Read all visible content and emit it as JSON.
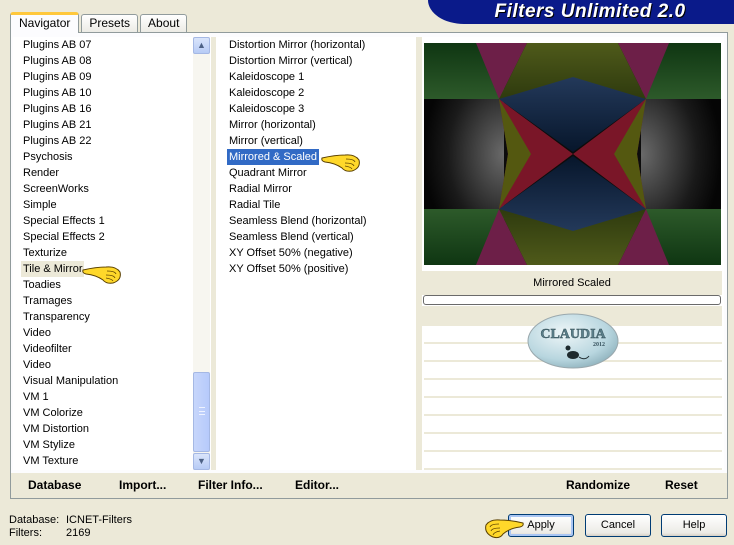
{
  "app": {
    "title": "Filters Unlimited 2.0"
  },
  "tabs": [
    {
      "label": "Navigator",
      "active": true
    },
    {
      "label": "Presets",
      "active": false
    },
    {
      "label": "About",
      "active": false
    }
  ],
  "categories": {
    "items": [
      "Plugins AB 07",
      "Plugins AB 08",
      "Plugins AB 09",
      "Plugins AB 10",
      "Plugins AB 16",
      "Plugins AB 21",
      "Plugins AB 22",
      "Psychosis",
      "Render",
      "ScreenWorks",
      "Simple",
      "Special Effects 1",
      "Special Effects 2",
      "Texturize",
      "Tile & Mirror",
      "Toadies",
      "Tramages",
      "Transparency",
      "Video",
      "Videofilter",
      "Video",
      "Visual Manipulation",
      "VM 1",
      "VM Colorize",
      "VM Distortion",
      "VM Stylize",
      "VM Texture"
    ],
    "selected": "Tile & Mirror",
    "scroll_position_fraction": 0.88
  },
  "filters": {
    "items": [
      "Distortion Mirror (horizontal)",
      "Distortion Mirror (vertical)",
      "Kaleidoscope 1",
      "Kaleidoscope 2",
      "Kaleidoscope 3",
      "Mirror (horizontal)",
      "Mirror (vertical)",
      "Mirrored & Scaled",
      "Quadrant Mirror",
      "Radial Mirror",
      "Radial Tile",
      "Seamless Blend (horizontal)",
      "Seamless Blend (vertical)",
      "XY Offset 50% (negative)",
      "XY Offset 50% (positive)"
    ],
    "selected": "Mirrored & Scaled"
  },
  "preview": {
    "filter_name": "Mirrored  Scaled",
    "progress_fraction": 0,
    "watermark_text": "CLAUDIA",
    "watermark_year": "2012"
  },
  "bottom_actions": {
    "database": "Database",
    "import": "Import...",
    "filter_info": "Filter Info...",
    "editor": "Editor...",
    "randomize": "Randomize",
    "reset": "Reset"
  },
  "status": {
    "database_label": "Database:",
    "database_value": "ICNET-Filters",
    "filters_label": "Filters:",
    "filters_value": "2169"
  },
  "buttons": {
    "apply": "Apply",
    "cancel": "Cancel",
    "help": "Help"
  },
  "colors": {
    "selection": "#316ac5",
    "banner": "#0a1a8a",
    "dialog_bg": "#ece9d8",
    "tab_highlight": "#ffc83c"
  }
}
